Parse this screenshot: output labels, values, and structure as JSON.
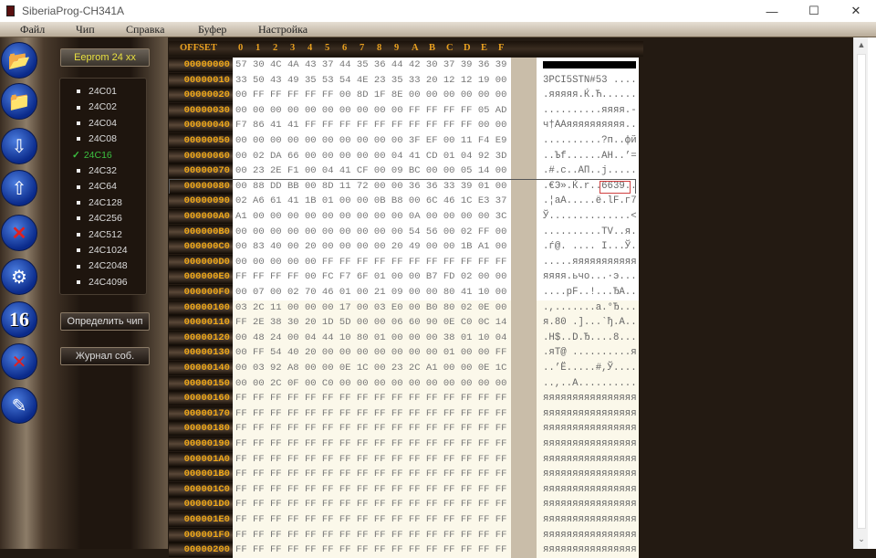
{
  "window": {
    "title": "SiberiaProg-CH341A",
    "minimize": "—",
    "maximize": "☐",
    "close": "✕"
  },
  "menu": [
    "Файл",
    "Чип",
    "Справка",
    "Буфер",
    "Настройка"
  ],
  "toolbar_icons": [
    "open-file-icon",
    "save-file-icon",
    "read-chip-icon",
    "write-chip-icon",
    "erase-chip-icon",
    "verify-chip-icon",
    "hex-16-icon",
    "compare-icon",
    "edit-icon"
  ],
  "toolbar_16": "16",
  "panel": {
    "chip_type_button": "Eeprom 24 xx",
    "detect_button": "Определить чип",
    "log_button": "Журнал соб.",
    "selected": "24C16",
    "chips": [
      "24C01",
      "24C02",
      "24C04",
      "24C08",
      "24C16",
      "24C32",
      "24C64",
      "24C128",
      "24C256",
      "24C512",
      "24C1024",
      "24C2048",
      "24C4096"
    ],
    "check": "✓"
  },
  "hex": {
    "offset_header": "OFFSET",
    "columns": [
      "0",
      "1",
      "2",
      "3",
      "4",
      "5",
      "6",
      "7",
      "8",
      "9",
      "A",
      "B",
      "C",
      "D",
      "E",
      "F"
    ],
    "highlight_row": "00000080",
    "highlight_ascii": "6639",
    "rows": [
      [
        "00000000",
        "57 30 4C 4A 43 37 44 35 36 44 42 30 37 39 36 39",
        ""
      ],
      [
        "00000010",
        "33 50 43 49 35 53 54 4E 23 35 33 20 12 12 19 00",
        "3PCI5STN#53 ...."
      ],
      [
        "00000020",
        "00 FF FF FF FF FF 00 8D 1F 8E 00 00 00 00 00 00",
        ".яяяяя.Ќ.Ћ......"
      ],
      [
        "00000030",
        "00 00 00 00 00 00 00 00 00 00 FF FF FF FF 05 AD",
        "..........яяяя.-"
      ],
      [
        "00000040",
        "F7 86 41 41 FF FF FF FF FF FF FF FF FF FF 00 00",
        "ч†AAяяяяяяяяяя.."
      ],
      [
        "00000050",
        "00 00 00 00 00 00 00 00 00 00 3F EF 00 11 F4 E9",
        "..........?п..фй"
      ],
      [
        "00000060",
        "00 02 DA 66 00 00 00 00 00 04 41 CD 01 04 92 3D",
        "..Ъf......AН..’="
      ],
      [
        "00000070",
        "00 23 2E F1 00 04 41 CF 00 09 BC 00 00 05 14 00",
        ".#.с..AП..ј....."
      ],
      [
        "00000080",
        "00 88 DD BB 00 8D 11 72 00 00 36 36 33 39 01 00",
        ".€Э».Ќ.r..6639.."
      ],
      [
        "00000090",
        "02 A6 61 41 1B 01 00 00 0B B8 00 6C 46 1C E3 37",
        ".¦aA.....ё.lF.г7"
      ],
      [
        "000000A0",
        "A1 00 00 00 00 00 00 00 00 00 0A 00 00 00 00 3C",
        "Ў..............<"
      ],
      [
        "000000B0",
        "00 00 00 00 00 00 00 00 00 00 54 56 00 02 FF 00",
        "..........TV..я."
      ],
      [
        "000000C0",
        "00 83 40 00 20 00 00 00 00 20 49 00 00 1B A1 00",
        ".ѓ@. .... I...Ў."
      ],
      [
        "000000D0",
        "00 00 00 00 00 FF FF FF FF FF FF FF FF FF FF FF",
        ".....яяяяяяяяяяя"
      ],
      [
        "000000E0",
        "FF FF FF FF 00 FC F7 6F 01 00 00 B7 FD 02 00 00",
        "яяяя.ьчo...·э..."
      ],
      [
        "000000F0",
        "00 07 00 02 70 46 01 00 21 09 00 00 80 41 10 00",
        "....pF..!...ЂA.."
      ],
      [
        "00000100",
        "03 2C 11 00 00 00 17 00 03 E0 00 B0 80 02 0E 00",
        ".,.......а.°Ђ..."
      ],
      [
        "00000110",
        "FF 2E 38 30 20 1D 5D 00 00 06 60 90 0E C0 0C 14",
        "я.80 .]...`ђ.А.."
      ],
      [
        "00000120",
        "00 48 24 00 04 44 10 80 01 00 00 00 38 01 10 04",
        ".H$..D.Ђ....8..."
      ],
      [
        "00000130",
        "00 FF 54 40 20 00 00 00 00 00 00 00 01 00 00 FF",
        ".яT@ ..........я"
      ],
      [
        "00000140",
        "00 03 92 A8 00 00 0E 1C 00 23 2C A1 00 00 0E 1C",
        "..’Ё.....#,Ў...."
      ],
      [
        "00000150",
        "00 00 2C 0F 00 C0 00 00 00 00 00 00 00 00 00 00",
        "..,..А.........."
      ],
      [
        "00000160",
        "FF FF FF FF FF FF FF FF FF FF FF FF FF FF FF FF",
        "яяяяяяяяяяяяяяяя"
      ],
      [
        "00000170",
        "FF FF FF FF FF FF FF FF FF FF FF FF FF FF FF FF",
        "яяяяяяяяяяяяяяяя"
      ],
      [
        "00000180",
        "FF FF FF FF FF FF FF FF FF FF FF FF FF FF FF FF",
        "яяяяяяяяяяяяяяяя"
      ],
      [
        "00000190",
        "FF FF FF FF FF FF FF FF FF FF FF FF FF FF FF FF",
        "яяяяяяяяяяяяяяяя"
      ],
      [
        "000001A0",
        "FF FF FF FF FF FF FF FF FF FF FF FF FF FF FF FF",
        "яяяяяяяяяяяяяяяя"
      ],
      [
        "000001B0",
        "FF FF FF FF FF FF FF FF FF FF FF FF FF FF FF FF",
        "яяяяяяяяяяяяяяяя"
      ],
      [
        "000001C0",
        "FF FF FF FF FF FF FF FF FF FF FF FF FF FF FF FF",
        "яяяяяяяяяяяяяяяя"
      ],
      [
        "000001D0",
        "FF FF FF FF FF FF FF FF FF FF FF FF FF FF FF FF",
        "яяяяяяяяяяяяяяяя"
      ],
      [
        "000001E0",
        "FF FF FF FF FF FF FF FF FF FF FF FF FF FF FF FF",
        "яяяяяяяяяяяяяяяя"
      ],
      [
        "000001F0",
        "FF FF FF FF FF FF FF FF FF FF FF FF FF FF FF FF",
        "яяяяяяяяяяяяяяяя"
      ],
      [
        "00000200",
        "FF FF FF FF FF FF FF FF FF FF FF FF FF FF FF FF",
        "яяяяяяяяяяяяяяяя"
      ]
    ]
  },
  "scrollbar": {
    "up": "▲",
    "down": "⌄"
  },
  "colors": {
    "offset": "#f0a818",
    "selected_chip": "#3cc040",
    "eeprom_label": "#e8e040"
  }
}
